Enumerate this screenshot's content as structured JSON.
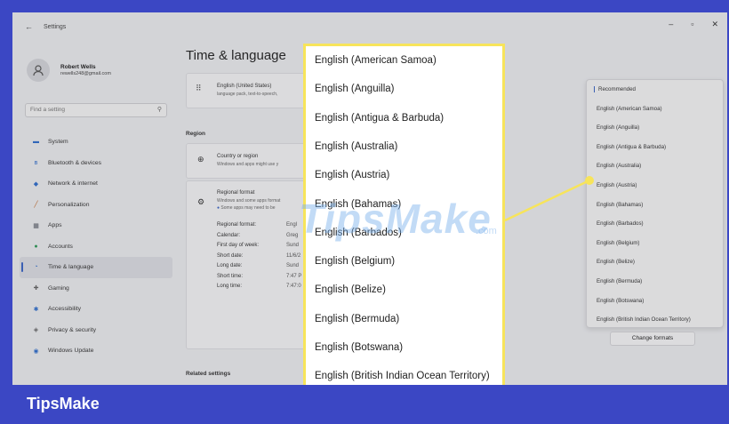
{
  "window": {
    "title": "Settings",
    "back_glyph": "←",
    "minimize_glyph": "–",
    "maximize_glyph": "▫",
    "close_glyph": "✕"
  },
  "profile": {
    "name": "Robert Wells",
    "email": "rewells248@gmail.com"
  },
  "search": {
    "placeholder": "Find a setting"
  },
  "sidebar": {
    "items": [
      {
        "label": "System",
        "icon": "system-icon",
        "color": "#2f6fd0"
      },
      {
        "label": "Bluetooth & devices",
        "icon": "bluetooth-icon",
        "color": "#2f6fd0"
      },
      {
        "label": "Network & internet",
        "icon": "network-icon",
        "color": "#2f6fd0"
      },
      {
        "label": "Personalization",
        "icon": "brush-icon",
        "color": "#c66a2a"
      },
      {
        "label": "Apps",
        "icon": "apps-icon",
        "color": "#555a66"
      },
      {
        "label": "Accounts",
        "icon": "accounts-icon",
        "color": "#2e9c59"
      },
      {
        "label": "Time & language",
        "icon": "globe-clock-icon",
        "color": "#2f6fd0"
      },
      {
        "label": "Gaming",
        "icon": "gaming-icon",
        "color": "#666"
      },
      {
        "label": "Accessibility",
        "icon": "accessibility-icon",
        "color": "#2f6fd0"
      },
      {
        "label": "Privacy & security",
        "icon": "shield-icon",
        "color": "#666"
      },
      {
        "label": "Windows Update",
        "icon": "update-icon",
        "color": "#2f6fd0"
      }
    ],
    "active_index": 6
  },
  "main": {
    "title": "Time & language",
    "language_card": {
      "title": "English (United States)",
      "subtitle": "language pack, text-to-speech,"
    },
    "region_header": "Region",
    "country_card": {
      "title": "Country or region",
      "subtitle": "Windows and apps might use y"
    },
    "regional_format": {
      "title": "Regional format",
      "subtitle": "Windows and some apps format",
      "note": "Some apps may need to be",
      "rows": [
        {
          "label": "Regional format:",
          "value": "Engl"
        },
        {
          "label": "Calendar:",
          "value": "Greg"
        },
        {
          "label": "First day of week:",
          "value": "Sund"
        },
        {
          "label": "Short date:",
          "value": "11/6/2"
        },
        {
          "label": "Long date:",
          "value": "Sund"
        },
        {
          "label": "Short time:",
          "value": "7:47 P"
        },
        {
          "label": "Long time:",
          "value": "7:47:0"
        }
      ]
    },
    "change_formats_button": "Change formats",
    "related_header": "Related settings"
  },
  "small_dropdown": {
    "items": [
      "Recommended",
      "English (American Samoa)",
      "English (Anguilla)",
      "English (Antigua & Barbuda)",
      "English (Australia)",
      "English (Austria)",
      "English (Bahamas)",
      "English (Barbados)",
      "English (Belgium)",
      "English (Belize)",
      "English (Bermuda)",
      "English (Botswana)",
      "English (British Indian Ocean Territory)"
    ]
  },
  "zoom_list": {
    "items": [
      "English (American Samoa)",
      "English (Anguilla)",
      "English (Antigua & Barbuda)",
      "English (Australia)",
      "English (Austria)",
      "English (Bahamas)",
      "English (Barbados)",
      "English (Belgium)",
      "English (Belize)",
      "English (Bermuda)",
      "English (Botswana)",
      "English (British Indian Ocean Territory)"
    ]
  },
  "watermark": {
    "text": "TipsMake",
    "suffix": ".com"
  },
  "footer": {
    "brand": "TipsMake"
  },
  "colors": {
    "frame": "#3b47c4",
    "highlight": "#f7e45a",
    "accent": "#3a66c9"
  }
}
